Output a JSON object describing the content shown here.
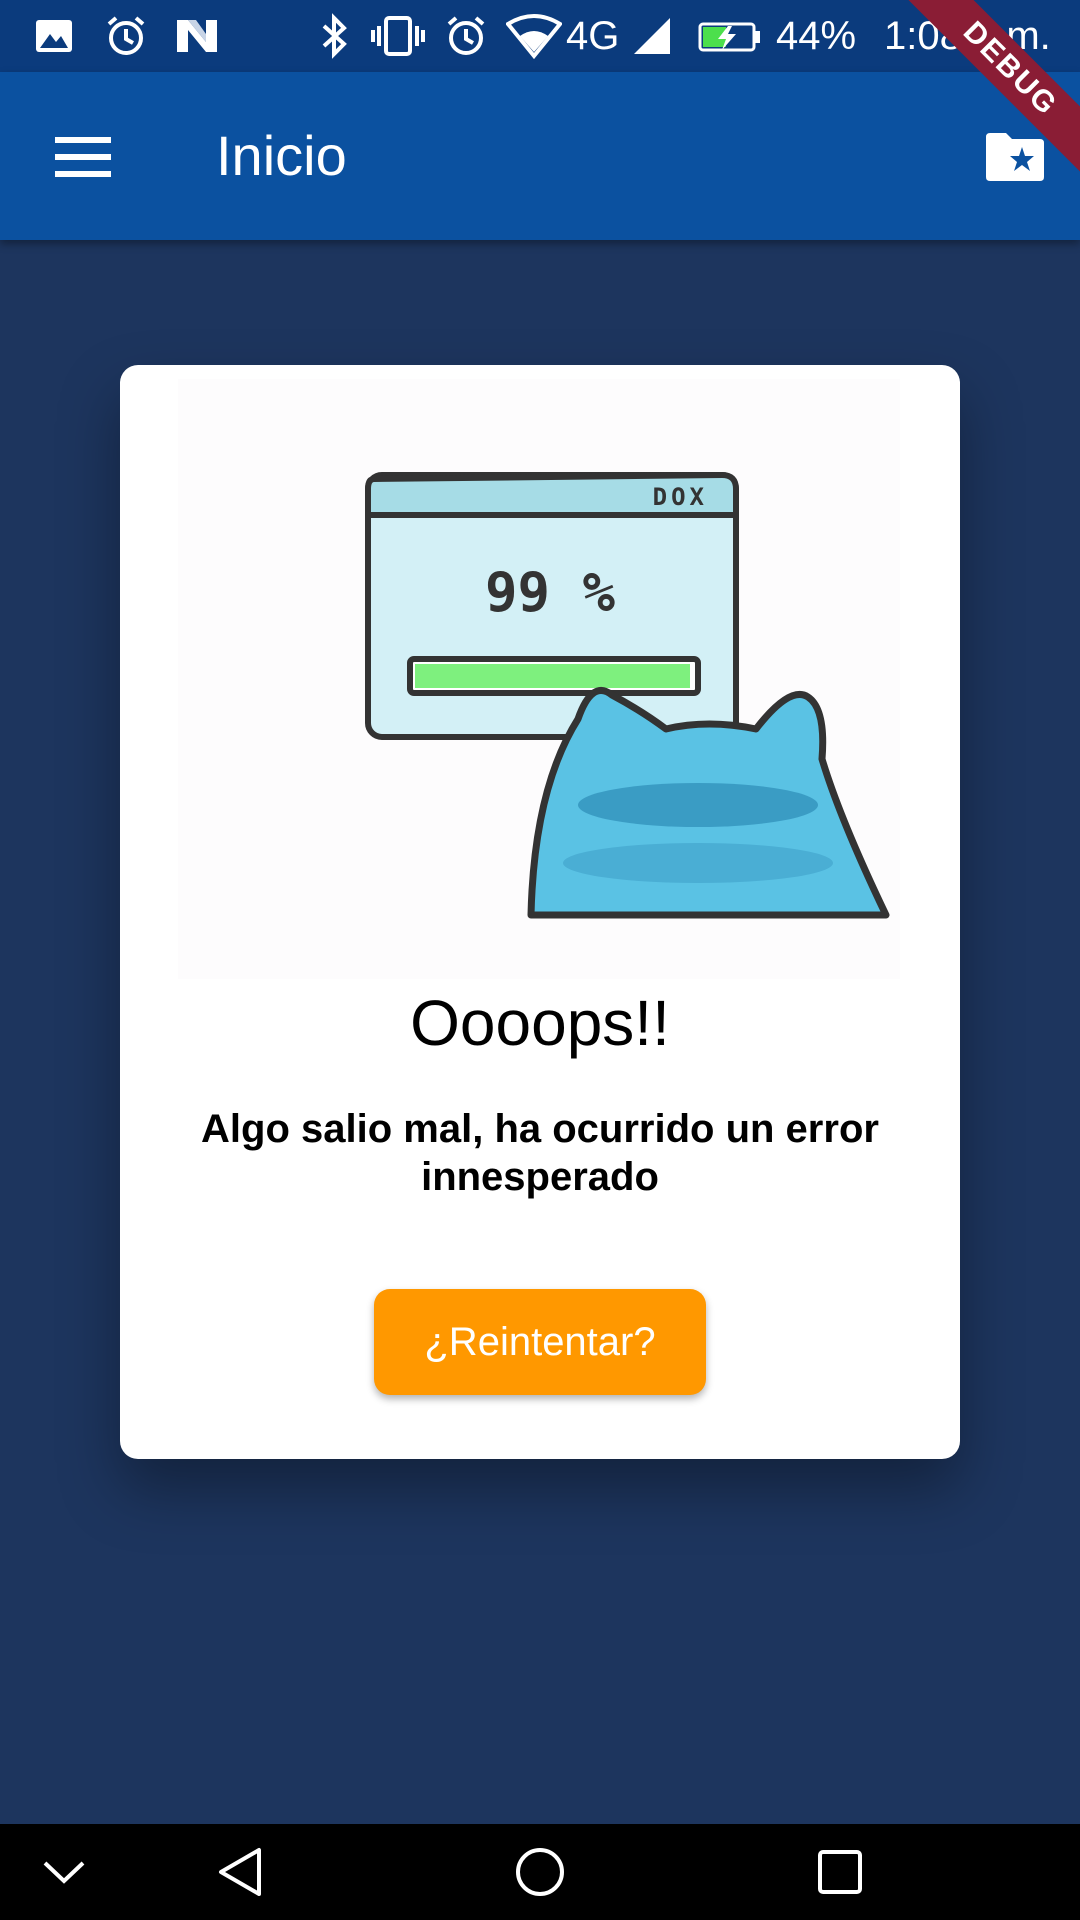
{
  "status_bar": {
    "icons": [
      "image-icon",
      "alarm-icon",
      "n-app-icon",
      "bluetooth-icon",
      "vibrate-icon",
      "alarm-icon",
      "wifi-icon",
      "signal-icon",
      "battery-charging-icon"
    ],
    "network": "4G",
    "battery": "44%",
    "time": "1:08 p.m."
  },
  "debug_banner": "DEBUG",
  "app_bar": {
    "title": "Inicio",
    "menu_icon": "hamburger-menu-icon",
    "action_icon": "folder-star-icon"
  },
  "error_card": {
    "illustration_text": {
      "window_label": "DOX",
      "progress": "99 %"
    },
    "progress_fraction": 0.99,
    "title": "Oooops!!",
    "message": "Algo salio mal, ha ocurrido un error innesperado",
    "retry_label": "¿Reintentar?"
  },
  "colors": {
    "status_bar": "#0b3b7d",
    "app_bar": "#0b51a0",
    "background": "#1d355e",
    "card": "#ffffff",
    "button": "#ff9800",
    "debug_ribbon": "#8a1d35"
  },
  "nav_bar": {
    "icons": [
      "chevron-down-icon",
      "back-triangle-icon",
      "home-circle-icon",
      "recents-square-icon"
    ]
  }
}
